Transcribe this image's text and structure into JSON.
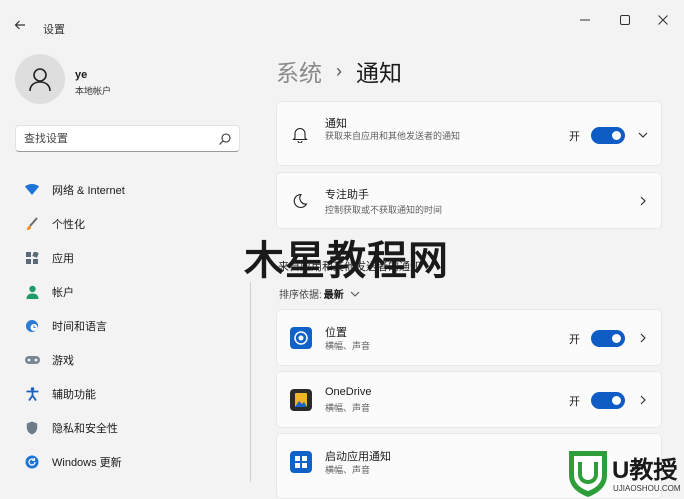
{
  "window": {
    "app_title": "设置",
    "back_icon": "back-arrow-icon",
    "controls": {
      "minimize": "—",
      "maximize": "☐",
      "close": "✕"
    }
  },
  "user": {
    "name": "ye",
    "account_type": "本地帐户"
  },
  "search": {
    "placeholder": "查找设置"
  },
  "nav": {
    "items": [
      {
        "label": "网络 & Internet",
        "icon": "wifi-icon"
      },
      {
        "label": "个性化",
        "icon": "brush-icon"
      },
      {
        "label": "应用",
        "icon": "apps-icon"
      },
      {
        "label": "帐户",
        "icon": "person-icon"
      },
      {
        "label": "时间和语言",
        "icon": "globe-clock-icon"
      },
      {
        "label": "游戏",
        "icon": "gamepad-icon"
      },
      {
        "label": "辅助功能",
        "icon": "accessibility-icon"
      },
      {
        "label": "隐私和安全性",
        "icon": "shield-icon"
      },
      {
        "label": "Windows 更新",
        "icon": "update-icon"
      }
    ]
  },
  "breadcrumb": {
    "parent": "系统",
    "separator": "›",
    "current": "通知"
  },
  "notifications": {
    "title": "通知",
    "description": "获取来自应用和其他发送者的通知",
    "state": "开",
    "on": true
  },
  "focus_assist": {
    "title": "专注助手",
    "description": "控制获取或不获取通知的时间"
  },
  "section": {
    "label": "来自应用和其他发送者的通知",
    "sort_label": "排序依据:",
    "sort_value": "最新"
  },
  "apps": [
    {
      "title": "位置",
      "description": "横幅、声音",
      "state": "开",
      "on": true,
      "icon": "location-icon"
    },
    {
      "title": "OneDrive",
      "description": "横幅、声音",
      "state": "开",
      "on": true,
      "icon": "onedrive-icon"
    },
    {
      "title": "启动应用通知",
      "description": "横幅、声音",
      "icon": "startup-apps-icon"
    }
  ],
  "watermark": {
    "text": "木星教程网",
    "logo_text": "U教授",
    "logo_url": "UJIAOSHOU.COM"
  },
  "colors": {
    "accent": "#0f5cc4",
    "background": "#f3f3f3",
    "card": "#fbfbfb"
  }
}
